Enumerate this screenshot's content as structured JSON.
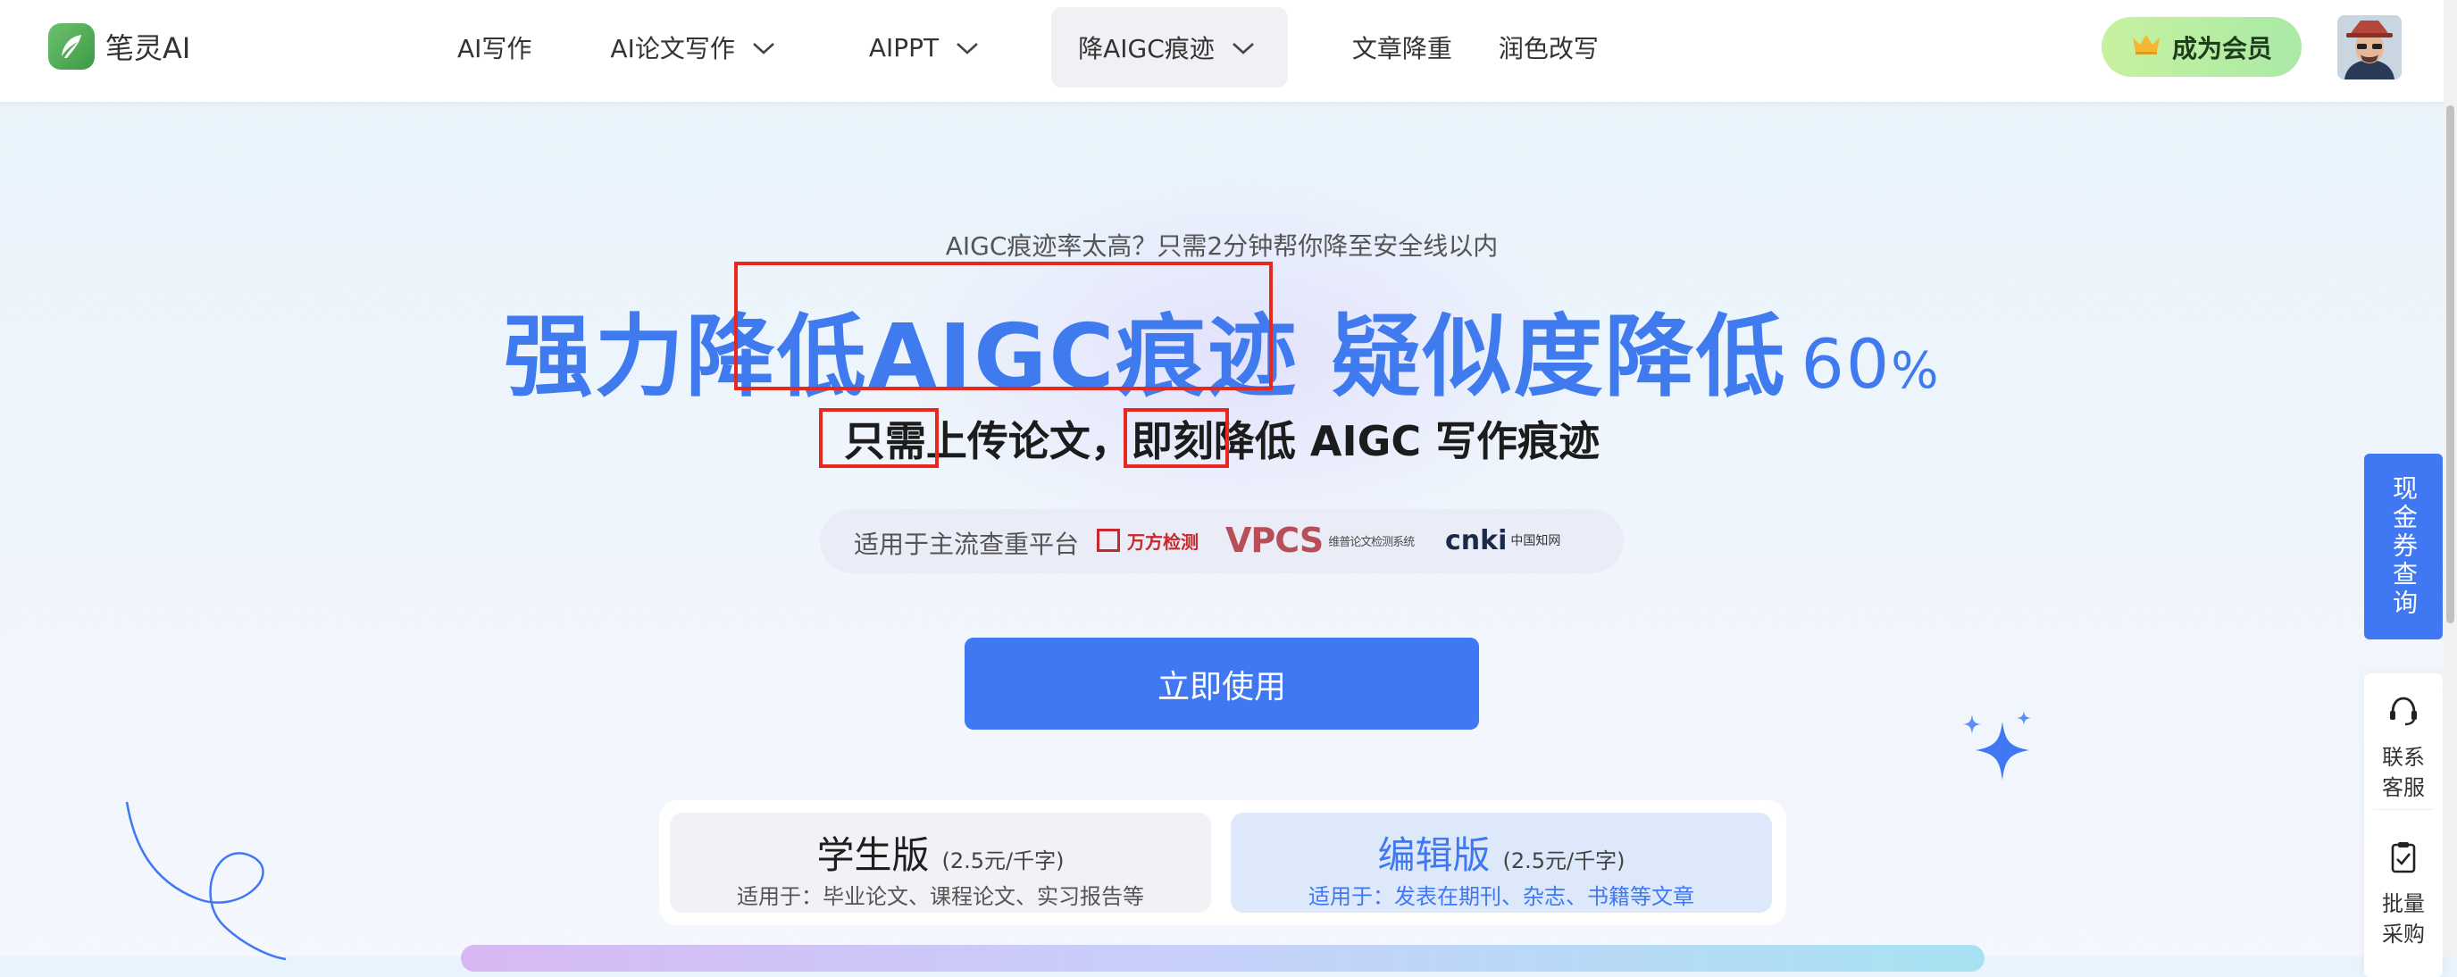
{
  "brand": {
    "name": "笔灵AI"
  },
  "nav": {
    "items": [
      {
        "label": "AI写作"
      },
      {
        "label": "AI论文写作"
      },
      {
        "label": "AIPPT"
      },
      {
        "label": "降AIGC痕迹"
      },
      {
        "label": "文章降重"
      },
      {
        "label": "润色改写"
      }
    ]
  },
  "header": {
    "vip_label": "成为会员"
  },
  "hero": {
    "subtitle": "AIGC痕迹率太高？只需2分钟帮你降至安全线以内",
    "title_part1": "强力",
    "title_part2": "降低AIGC痕迹",
    "title_part3": " 疑似度降低",
    "title_number": "60",
    "title_percent": "%",
    "line2_part1": "只需",
    "line2_part2": "上传论文，",
    "line2_part3": "即刻",
    "line2_part4": "降低 AIGC 写作痕迹",
    "platform_label_1": "适用于",
    "platform_label_2": "主流查重平台",
    "platforms": {
      "wanfang": "万方检测",
      "vpcs": "VPCS",
      "vpcs_sub": "维普论文检测系统",
      "cnki": "cnki",
      "cnki_sub": "中国知网"
    },
    "cta_label": "立即使用"
  },
  "plans": [
    {
      "name": "学生版",
      "price": "(2.5元/千字)",
      "desc": "适用于：毕业论文、课程论文、实习报告等"
    },
    {
      "name": "编辑版",
      "price": "(2.5元/千字)",
      "desc": "适用于：发表在期刊、杂志、书籍等文章"
    }
  ],
  "side": {
    "coupon_label": "现金券查询",
    "contact_label": "联系客服",
    "bulk_label": "批量采购"
  },
  "colors": {
    "accent": "#3f78f2",
    "highlight_box": "#e8281d",
    "vip_bg": "#c8f1a0"
  }
}
